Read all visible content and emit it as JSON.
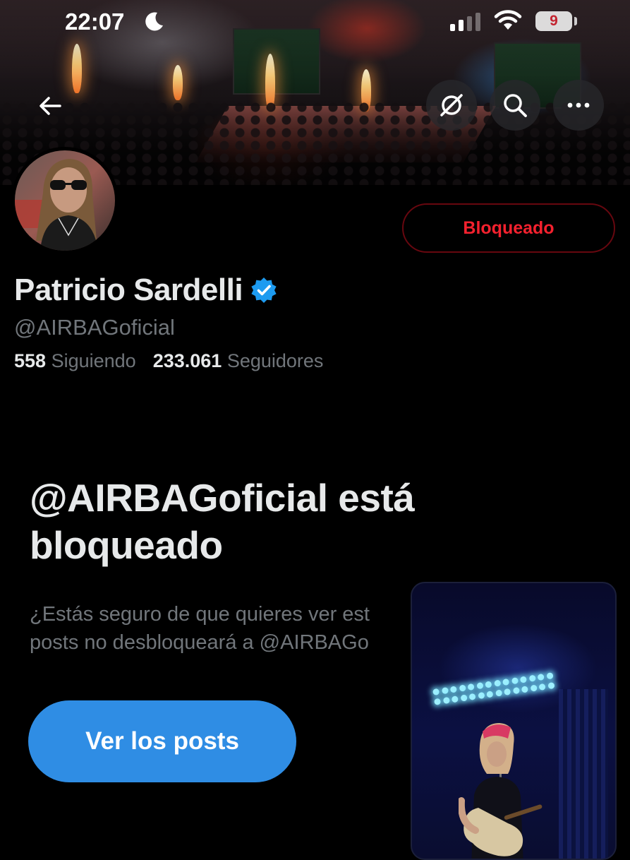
{
  "status_bar": {
    "time": "22:07",
    "battery": "9",
    "icons": [
      "moon-icon",
      "cellular-signal-icon",
      "wifi-icon",
      "battery-icon"
    ]
  },
  "header": {
    "icons": [
      "back-arrow-icon",
      "grok-icon",
      "search-icon",
      "more-icon"
    ]
  },
  "profile": {
    "name": "Patricio Sardelli",
    "verified": true,
    "handle": "@AIRBAGoficial",
    "following_count": "558",
    "following_label": "Siguiendo",
    "followers_count": "233.061",
    "followers_label": "Seguidores",
    "blocked_button": "Bloqueado"
  },
  "blocked_notice": {
    "title": "@AIRBAGoficial está bloqueado",
    "line1": "¿Estás seguro de que quieres ver est",
    "line2": "posts no desbloqueará a @AIRBAGo",
    "button": "Ver los posts"
  },
  "colors": {
    "background": "#000000",
    "primary_text": "#e7e9ea",
    "secondary_text": "#71767b",
    "danger": "#f4212e",
    "accent_blue": "#2f8de4",
    "verified_blue": "#1d9bf0"
  }
}
